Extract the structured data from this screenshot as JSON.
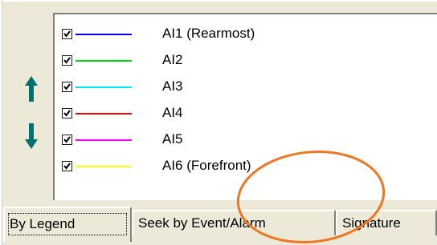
{
  "controls": {
    "move_up_icon": "arrow-up-icon",
    "move_down_icon": "arrow-down-icon",
    "accent_color": "#007070"
  },
  "legend_items": [
    {
      "label": "AI1 (Rearmost)",
      "color": "#0000ff",
      "checked": true
    },
    {
      "label": "AI2",
      "color": "#00dd00",
      "checked": true
    },
    {
      "label": "AI3",
      "color": "#00e8f0",
      "checked": true
    },
    {
      "label": "AI4",
      "color": "#ee0000",
      "checked": true
    },
    {
      "label": "AI5",
      "color": "#ff00ff",
      "checked": true
    },
    {
      "label": "AI6 (Forefront)",
      "color": "#ffff00",
      "checked": true
    }
  ],
  "tabs": [
    {
      "label": "By Legend",
      "active": true
    },
    {
      "label": "Seek by Event/Alarm",
      "active": false
    },
    {
      "label": "Signature",
      "active": false
    }
  ],
  "annotation": {
    "shape": "ellipse",
    "color": "#ee7722"
  }
}
